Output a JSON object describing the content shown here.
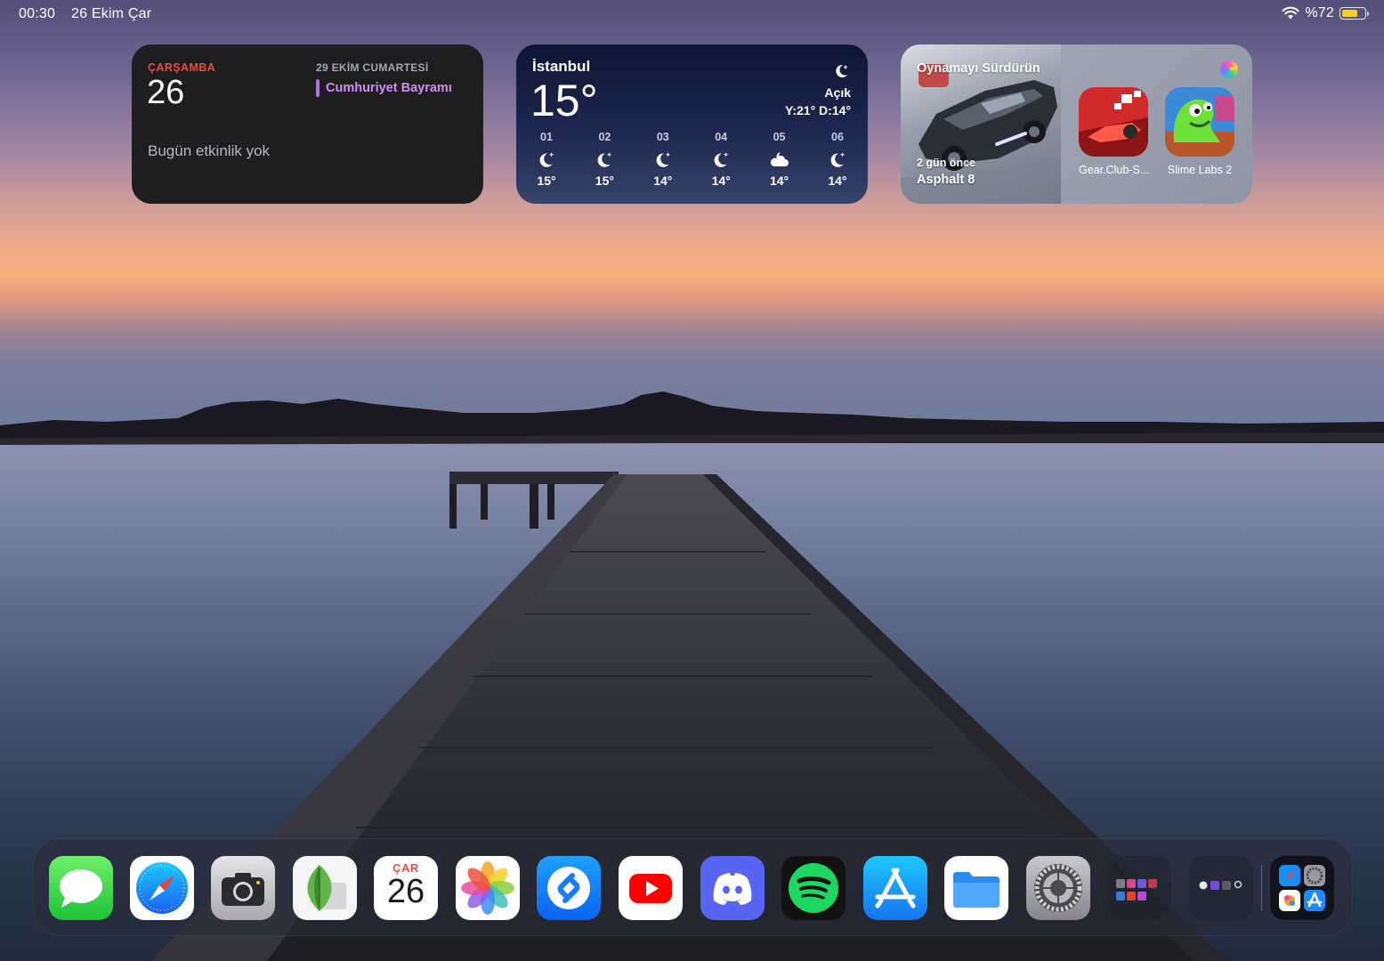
{
  "status_bar": {
    "time": "00:30",
    "date": "26 Ekim Çar",
    "battery_text": "%72",
    "battery_level": 0.72,
    "battery_color": "#f4cf2e"
  },
  "calendar_widget": {
    "weekday": "ÇARŞAMBA",
    "day": "26",
    "upcoming_date": "29 EKİM CUMARTESİ",
    "event_title": "Cumhuriyet Bayramı",
    "no_events": "Bugün etkinlik yok"
  },
  "weather_widget": {
    "city": "İstanbul",
    "temperature": "15°",
    "condition": "Açık",
    "hi_lo": "Y:21° D:14°",
    "hours": [
      {
        "label": "01",
        "icon": "moon-stars-icon",
        "temp": "15°"
      },
      {
        "label": "02",
        "icon": "moon-stars-icon",
        "temp": "15°"
      },
      {
        "label": "03",
        "icon": "moon-stars-icon",
        "temp": "14°"
      },
      {
        "label": "04",
        "icon": "moon-stars-icon",
        "temp": "14°"
      },
      {
        "label": "05",
        "icon": "cloud-moon-icon",
        "temp": "14°"
      },
      {
        "label": "06",
        "icon": "moon-stars-icon",
        "temp": "14°"
      }
    ]
  },
  "game_widget": {
    "title": "Oynamayı Sürdürün",
    "last_played_ago": "2 gün önce",
    "last_played_name": "Asphalt 8",
    "apps": [
      {
        "label": "Gear.Club-S..."
      },
      {
        "label": "Slime Labs 2"
      }
    ]
  },
  "dock": {
    "apps": [
      {
        "name": "Messages",
        "icon": "messages-icon"
      },
      {
        "name": "Safari",
        "icon": "safari-icon"
      },
      {
        "name": "Camera",
        "icon": "camera-icon"
      },
      {
        "name": "Snapseed",
        "icon": "snapseed-icon"
      },
      {
        "name": "Calendar",
        "icon": "calendar-icon",
        "month": "ÇAR",
        "day": "26"
      },
      {
        "name": "Photos",
        "icon": "photos-icon"
      },
      {
        "name": "Shazam",
        "icon": "shazam-icon"
      },
      {
        "name": "YouTube",
        "icon": "youtube-icon"
      },
      {
        "name": "Discord",
        "icon": "discord-icon"
      },
      {
        "name": "Spotify",
        "icon": "spotify-icon"
      },
      {
        "name": "App Store",
        "icon": "app-store-icon"
      },
      {
        "name": "Files",
        "icon": "files-icon"
      },
      {
        "name": "Settings",
        "icon": "settings-icon"
      }
    ],
    "folders": [
      "games-folder",
      "utilities-folder"
    ],
    "recent_apps_library": "app-library-icon"
  }
}
